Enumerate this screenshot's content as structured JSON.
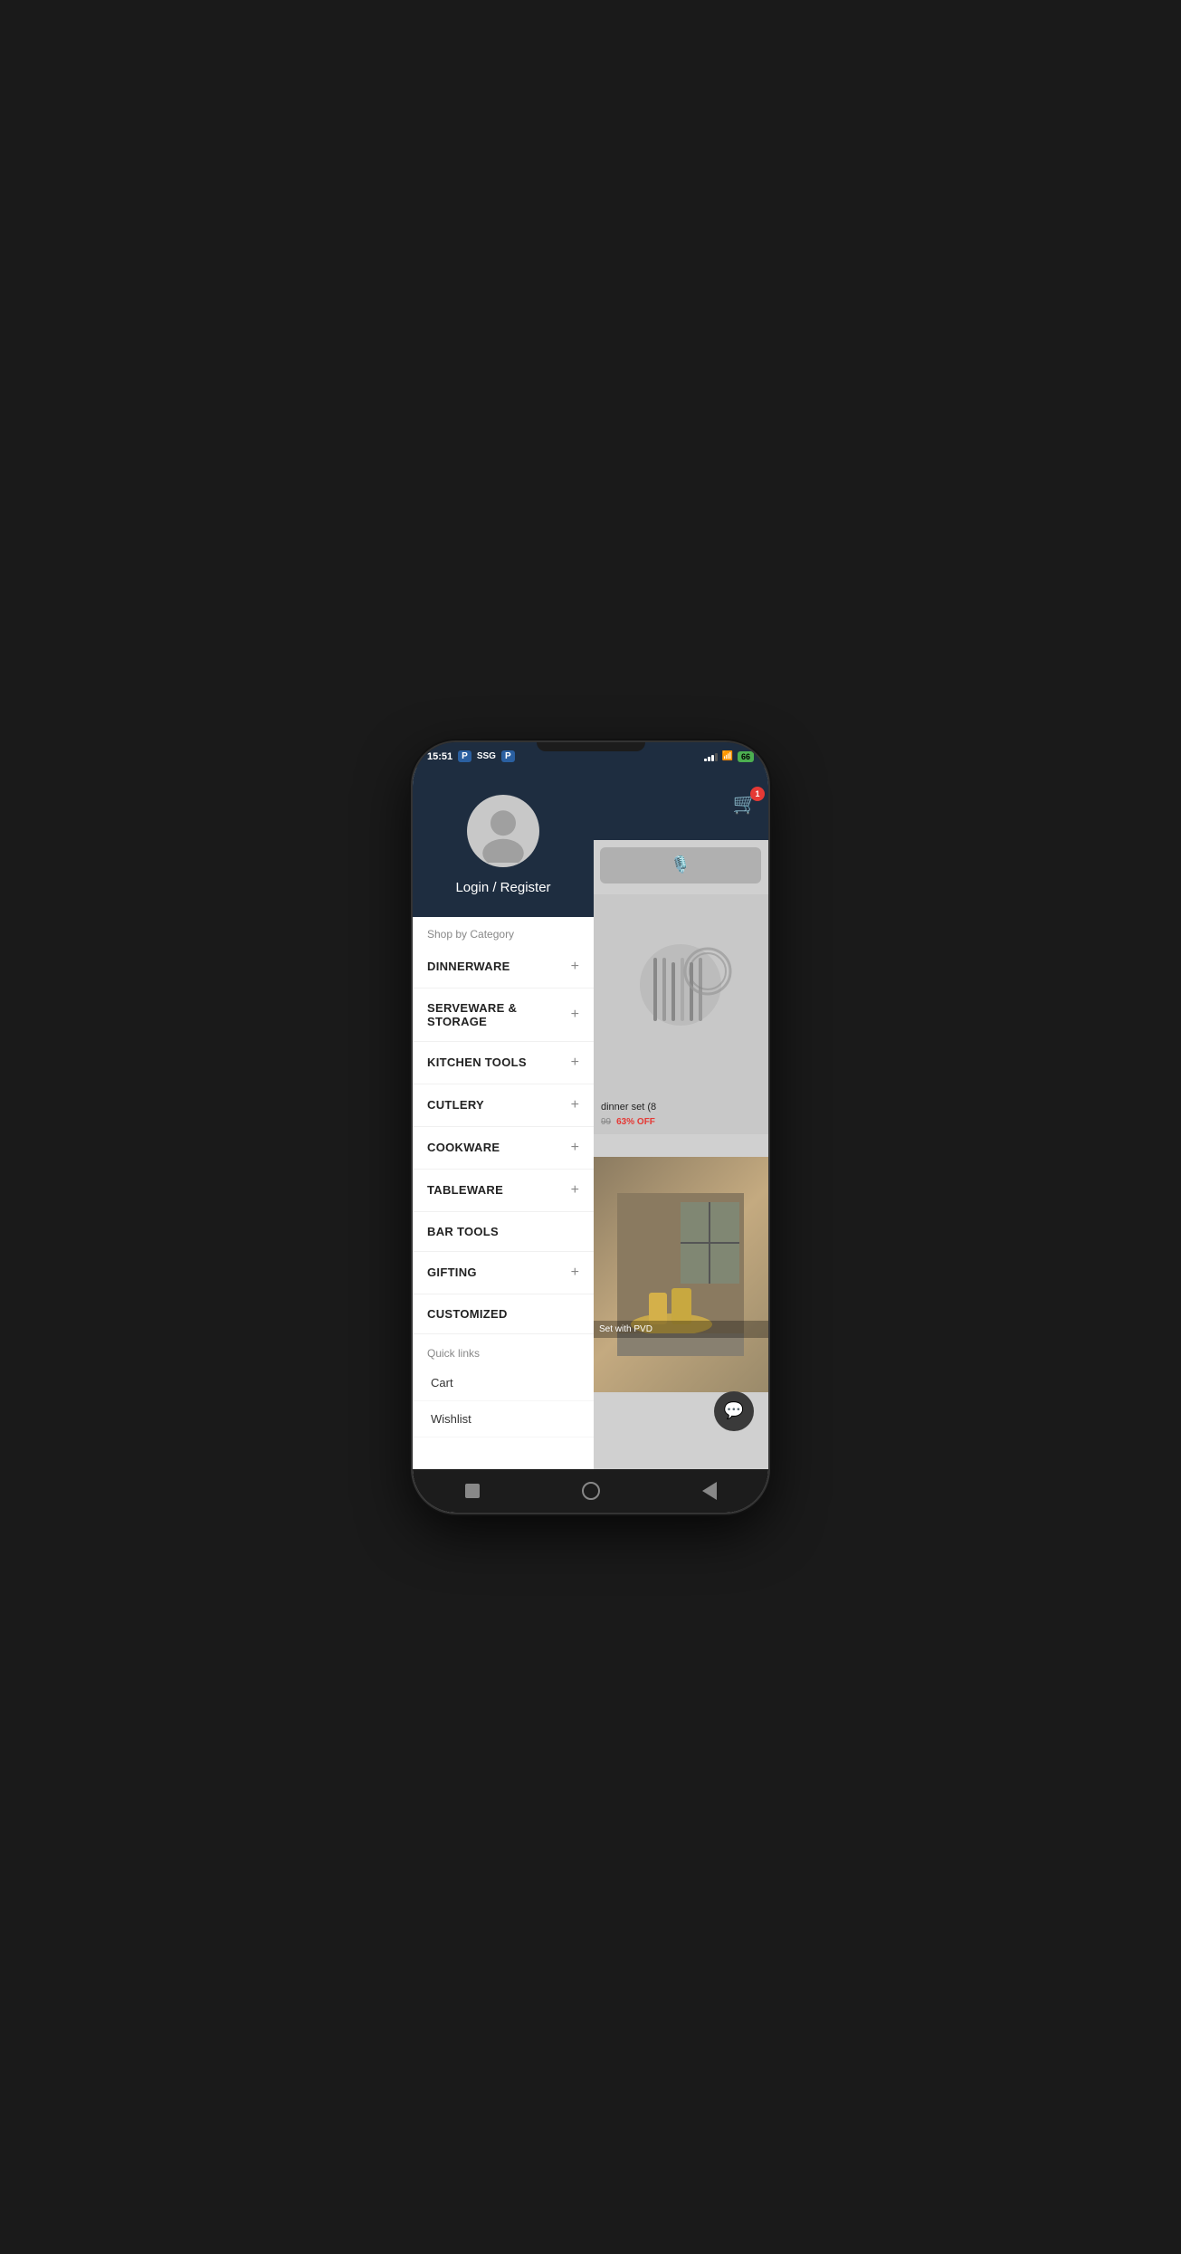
{
  "status_bar": {
    "time": "15:51",
    "battery": "66",
    "carrier1": "P",
    "carrier2": "SSG",
    "carrier3": "P"
  },
  "header": {
    "cart_badge": "1",
    "search_placeholder": ""
  },
  "drawer": {
    "profile": {
      "login_label": "Login / Register"
    },
    "shop_section_label": "Shop by Category",
    "categories": [
      {
        "id": "dinnerware",
        "label": "DINNERWARE",
        "has_expand": true
      },
      {
        "id": "serveware",
        "label": "SERVEWARE & STORAGE",
        "has_expand": true
      },
      {
        "id": "kitchen-tools",
        "label": "KITCHEN TOOLS",
        "has_expand": true
      },
      {
        "id": "cutlery",
        "label": "CUTLERY",
        "has_expand": true
      },
      {
        "id": "cookware",
        "label": "COOKWARE",
        "has_expand": true
      },
      {
        "id": "tableware",
        "label": "TABLEWARE",
        "has_expand": true
      },
      {
        "id": "bar-tools",
        "label": "BAR TOOLS",
        "has_expand": false
      },
      {
        "id": "gifting",
        "label": "GIFTING",
        "has_expand": true
      },
      {
        "id": "customized",
        "label": "CUSTOMIZED",
        "has_expand": false
      }
    ],
    "quick_links_label": "Quick links",
    "quick_links": [
      {
        "id": "cart",
        "label": "Cart"
      },
      {
        "id": "wishlist",
        "label": "Wishlist"
      }
    ]
  },
  "product_1": {
    "title": "dinner set (8",
    "old_price": "99",
    "discount": "63% OFF"
  },
  "product_2": {
    "caption": "Set with PVD"
  },
  "icons": {
    "cart": "🛒",
    "mic": "🎤",
    "chat": "💬",
    "plus": "+"
  },
  "nav": {
    "square_label": "recent-apps",
    "circle_label": "home",
    "triangle_label": "back"
  }
}
